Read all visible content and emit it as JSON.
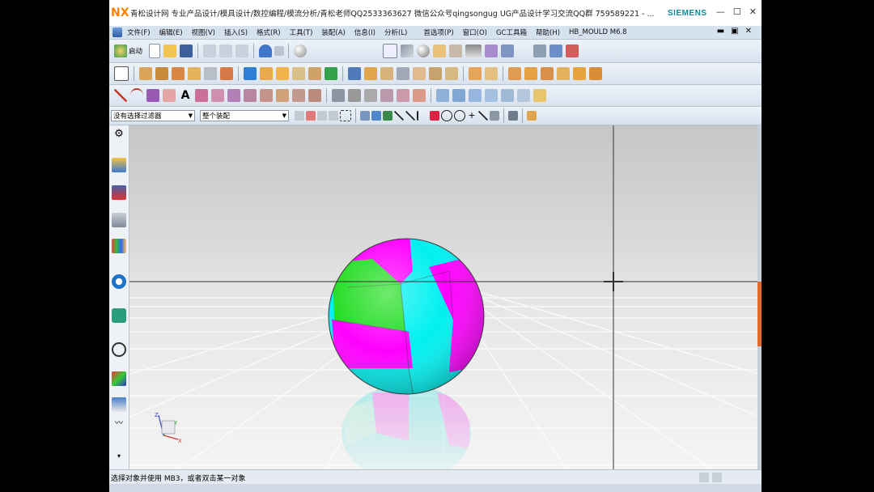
{
  "title_bar": {
    "logo": "NX",
    "title": "青松设计网 专业产品设计/模具设计/数控编程/模流分析/青松老师QQ2533363627 微信公众号qingsongug UG产品设计学习交流QQ群 759589221 - ...",
    "brand": "SIEMENS",
    "min": "—",
    "max": "☐",
    "close": "✕"
  },
  "menu": {
    "items": [
      "文件(F)",
      "编辑(E)",
      "视图(V)",
      "插入(S)",
      "格式(R)",
      "工具(T)",
      "装配(A)",
      "信息(I)",
      "分析(L)",
      "首选项(P)",
      "窗口(O)",
      "GC工具箱",
      "帮助(H)",
      "HB_MOULD M6.8"
    ],
    "window_controls": [
      "▬",
      "▣",
      "✕"
    ]
  },
  "toolbar": {
    "start_label": "启动",
    "overflow": "»"
  },
  "selection_bar": {
    "filter_value": "没有选择过滤器",
    "scope_value": "整个装配"
  },
  "status": {
    "prompt": "选择对象并使用 MB3，或者双击某一对象"
  },
  "viewport": {
    "ball_colors": [
      "#ff00ff",
      "#00ffff",
      "#22dd22"
    ],
    "triad_labels": [
      "Z",
      "Y",
      "X"
    ]
  }
}
